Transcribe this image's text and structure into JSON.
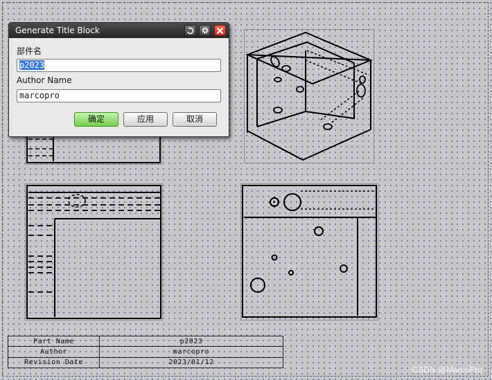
{
  "dialog": {
    "title": "Generate Title Block",
    "part_label": "部件名",
    "part_value": "p2023",
    "author_label": "Author Name",
    "author_value": "marcopro",
    "ok_label": "确定",
    "apply_label": "应用",
    "cancel_label": "取消",
    "icons": [
      "reset-icon",
      "settings-gear-icon",
      "close-icon"
    ]
  },
  "title_block": {
    "rows": [
      {
        "label": "Part Name",
        "value": "p2023"
      },
      {
        "label": "Author",
        "value": "marcopro"
      },
      {
        "label": "Revision Date",
        "value": "2023/01/12"
      }
    ]
  },
  "watermark": "CSDN @MarcoPro",
  "colors": {
    "sheet": "#c8c8cc",
    "grid_dot": "#5a6aa0",
    "ok_button": "#6fd04a",
    "close_button": "#c8261a",
    "selection": "#3a78d8"
  }
}
